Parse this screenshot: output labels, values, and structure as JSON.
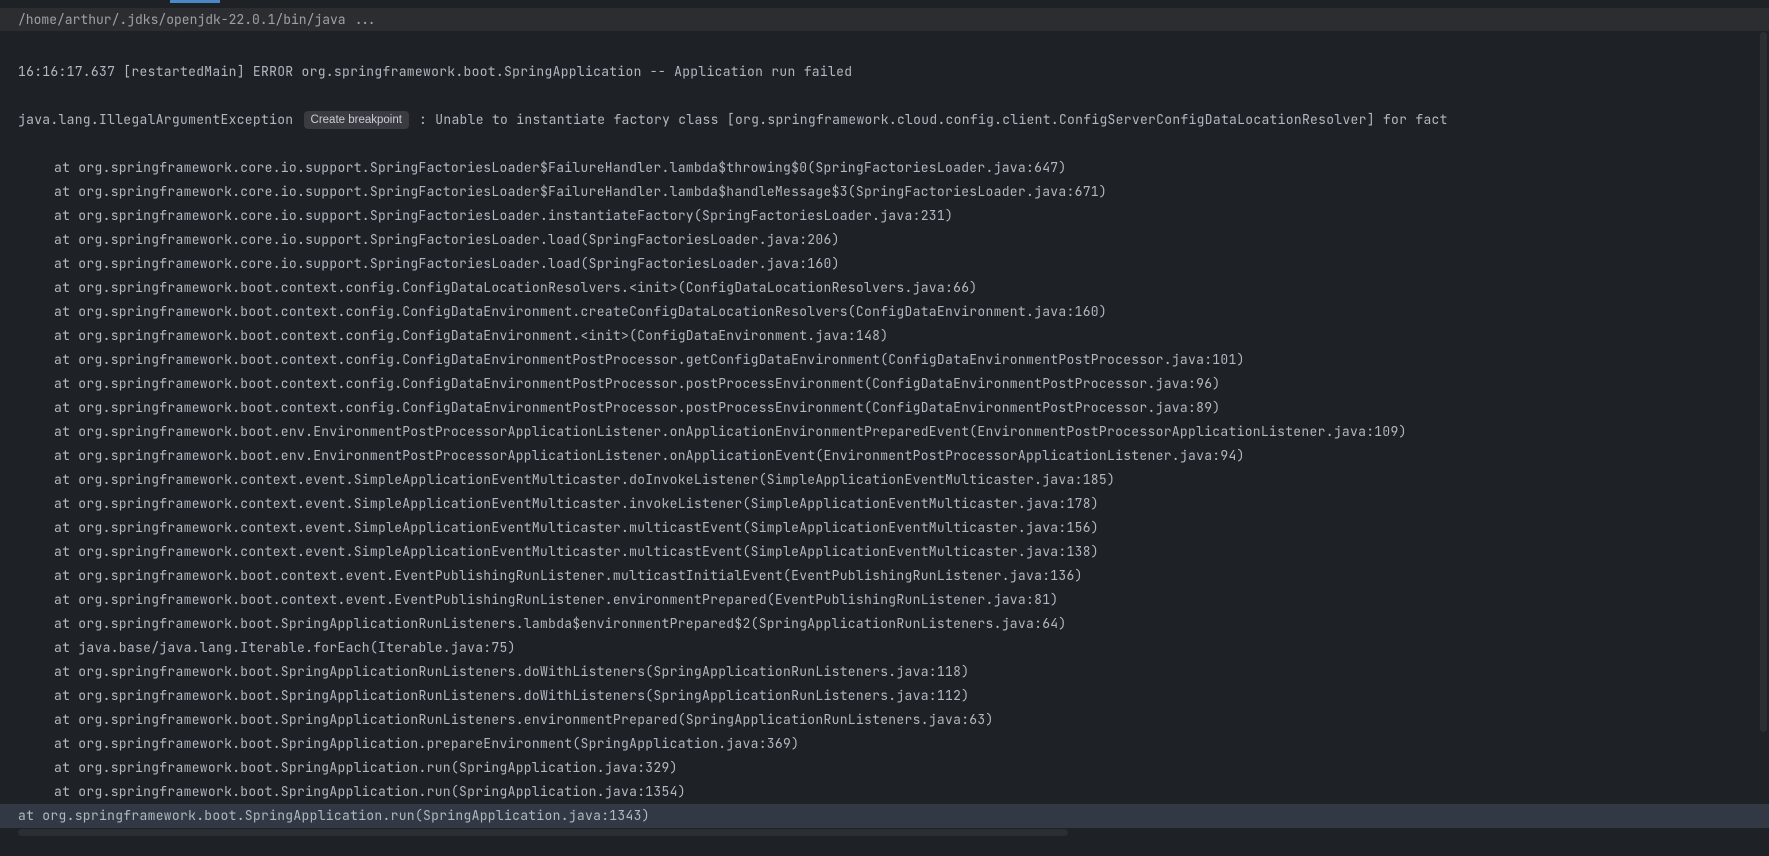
{
  "commandLine": "/home/arthur/.jdks/openjdk-22.0.1/bin/java ...",
  "logLine": "16:16:17.637 [restartedMain] ERROR org.springframework.boot.SpringApplication -- Application run failed",
  "exceptionClass": "java.lang.IllegalArgumentException",
  "breakpointLabel": "Create breakpoint",
  "exceptionMessage": ": Unable to instantiate factory class [org.springframework.cloud.config.client.ConfigServerConfigDataLocationResolver] for fact",
  "stackLines": [
    "at org.springframework.core.io.support.SpringFactoriesLoader$FailureHandler.lambda$throwing$0(SpringFactoriesLoader.java:647)",
    "at org.springframework.core.io.support.SpringFactoriesLoader$FailureHandler.lambda$handleMessage$3(SpringFactoriesLoader.java:671)",
    "at org.springframework.core.io.support.SpringFactoriesLoader.instantiateFactory(SpringFactoriesLoader.java:231)",
    "at org.springframework.core.io.support.SpringFactoriesLoader.load(SpringFactoriesLoader.java:206)",
    "at org.springframework.core.io.support.SpringFactoriesLoader.load(SpringFactoriesLoader.java:160)",
    "at org.springframework.boot.context.config.ConfigDataLocationResolvers.<init>(ConfigDataLocationResolvers.java:66)",
    "at org.springframework.boot.context.config.ConfigDataEnvironment.createConfigDataLocationResolvers(ConfigDataEnvironment.java:160)",
    "at org.springframework.boot.context.config.ConfigDataEnvironment.<init>(ConfigDataEnvironment.java:148)",
    "at org.springframework.boot.context.config.ConfigDataEnvironmentPostProcessor.getConfigDataEnvironment(ConfigDataEnvironmentPostProcessor.java:101)",
    "at org.springframework.boot.context.config.ConfigDataEnvironmentPostProcessor.postProcessEnvironment(ConfigDataEnvironmentPostProcessor.java:96)",
    "at org.springframework.boot.context.config.ConfigDataEnvironmentPostProcessor.postProcessEnvironment(ConfigDataEnvironmentPostProcessor.java:89)",
    "at org.springframework.boot.env.EnvironmentPostProcessorApplicationListener.onApplicationEnvironmentPreparedEvent(EnvironmentPostProcessorApplicationListener.java:109)",
    "at org.springframework.boot.env.EnvironmentPostProcessorApplicationListener.onApplicationEvent(EnvironmentPostProcessorApplicationListener.java:94)",
    "at org.springframework.context.event.SimpleApplicationEventMulticaster.doInvokeListener(SimpleApplicationEventMulticaster.java:185)",
    "at org.springframework.context.event.SimpleApplicationEventMulticaster.invokeListener(SimpleApplicationEventMulticaster.java:178)",
    "at org.springframework.context.event.SimpleApplicationEventMulticaster.multicastEvent(SimpleApplicationEventMulticaster.java:156)",
    "at org.springframework.context.event.SimpleApplicationEventMulticaster.multicastEvent(SimpleApplicationEventMulticaster.java:138)",
    "at org.springframework.boot.context.event.EventPublishingRunListener.multicastInitialEvent(EventPublishingRunListener.java:136)",
    "at org.springframework.boot.context.event.EventPublishingRunListener.environmentPrepared(EventPublishingRunListener.java:81)",
    "at org.springframework.boot.SpringApplicationRunListeners.lambda$environmentPrepared$2(SpringApplicationRunListeners.java:64)",
    "at java.base/java.lang.Iterable.forEach(Iterable.java:75)",
    "at org.springframework.boot.SpringApplicationRunListeners.doWithListeners(SpringApplicationRunListeners.java:118)",
    "at org.springframework.boot.SpringApplicationRunListeners.doWithListeners(SpringApplicationRunListeners.java:112)",
    "at org.springframework.boot.SpringApplicationRunListeners.environmentPrepared(SpringApplicationRunListeners.java:63)",
    "at org.springframework.boot.SpringApplication.prepareEnvironment(SpringApplication.java:369)",
    "at org.springframework.boot.SpringApplication.run(SpringApplication.java:329)",
    "at org.springframework.boot.SpringApplication.run(SpringApplication.java:1354)",
    "at org.springframework.boot.SpringApplication.run(SpringApplication.java:1343)"
  ],
  "highlightedLineIndex": 27
}
